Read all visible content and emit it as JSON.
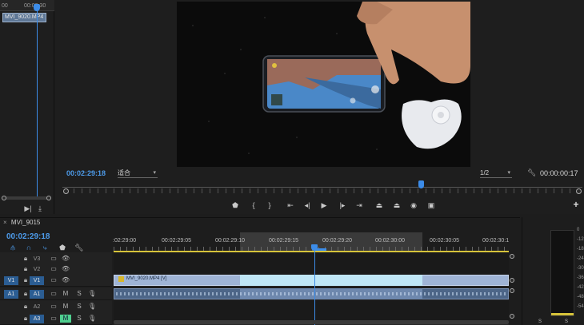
{
  "source": {
    "ruler_ticks": [
      "00",
      "00:00:30"
    ],
    "clip_name": "MVI_9020.MP4"
  },
  "program": {
    "timecode": "00:02:29:18",
    "fit": "适合",
    "resolution": "1/2",
    "duration": "00:00:00:17",
    "transport": [
      {
        "name": "marker-icon",
        "glyph": "⬟"
      },
      {
        "name": "mark-in-icon",
        "glyph": "{"
      },
      {
        "name": "mark-out-icon",
        "glyph": "}"
      },
      {
        "name": "go-to-in-icon",
        "glyph": "⇤"
      },
      {
        "name": "step-back-icon",
        "glyph": "◀|"
      },
      {
        "name": "play-icon",
        "glyph": "▶"
      },
      {
        "name": "step-forward-icon",
        "glyph": "|▶"
      },
      {
        "name": "go-to-out-icon",
        "glyph": "⇥"
      },
      {
        "name": "lift-icon",
        "glyph": "⏏"
      },
      {
        "name": "extract-icon",
        "glyph": "⏏"
      },
      {
        "name": "export-frame-icon",
        "glyph": "◉"
      },
      {
        "name": "compare-icon",
        "glyph": "▣"
      }
    ],
    "add_button": "+"
  },
  "timeline": {
    "sequence_name": "MVI_9015",
    "close": "×",
    "timecode": "00:02:29:18",
    "ruler_labels": [
      ":02:29:00",
      "00:02:29:05",
      "00:02:29:10",
      "00:02:29:15",
      "00:02:29:20",
      "00:02:30:00",
      "00:02:30:05",
      "00:02:30:1"
    ],
    "tracks": [
      {
        "id": "V3",
        "source_target": ""
      },
      {
        "id": "V2",
        "source_target": ""
      },
      {
        "id": "V1",
        "source_target": "V1"
      },
      {
        "id": "A1",
        "source_target": "A1"
      },
      {
        "id": "A2",
        "source_target": ""
      },
      {
        "id": "A3",
        "source_target": ""
      }
    ],
    "video_clip_label": "MVI_9020.MP4 [V]",
    "mute_label": "M",
    "solo_label": "S",
    "selected_M_label": "M"
  },
  "meters": {
    "scale": [
      "0",
      "-12",
      "-18",
      "-24",
      "-30",
      "-36",
      "-42",
      "-48",
      "-54"
    ],
    "solo_labels": [
      "S",
      "S"
    ]
  },
  "colors": {
    "accent": "#3c8ce8",
    "work_area": "#d6c33a",
    "video_clip": "#9fb4d6",
    "audio_clip": "#4d6688"
  }
}
